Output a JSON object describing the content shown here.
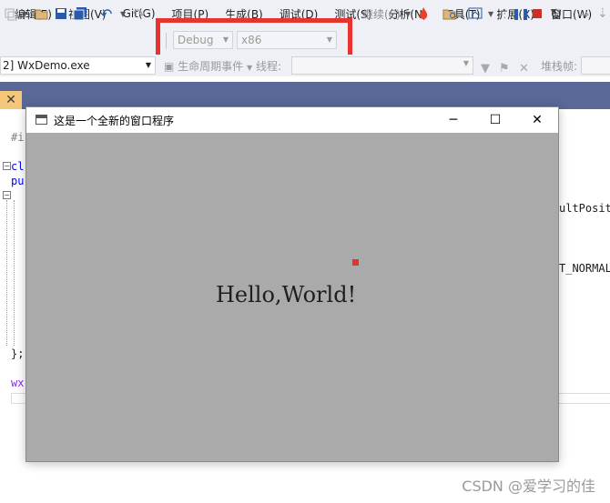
{
  "menu": [
    "编辑(E)",
    "视图(V)",
    "Git(G)",
    "项目(P)",
    "生成(B)",
    "调试(D)",
    "测试(S)",
    "分析(N)",
    "工具(T)",
    "扩展(X)",
    "窗口(W)"
  ],
  "toolbar": {
    "configuration": "Debug",
    "platform": "x86",
    "continue_label": "继续(C)"
  },
  "toolbar2": {
    "process": "2] WxDemo.exe",
    "lifecycle_label": "生命周期事件",
    "thread_label": "线程:",
    "stack_label": "堆栈帧:"
  },
  "editor": {
    "line1": "#i",
    "line2": "cl",
    "line3": "pu",
    "line4": "};",
    "line5": "wx",
    "right1": "ultPosit",
    "right2": "T_NORMAL"
  },
  "app_window": {
    "title": "这是一个全新的窗口程序",
    "text": "Hello,World!",
    "minimize": "─",
    "maximize": "☐",
    "close": "✕",
    "background": "#aaaaaa",
    "dot_color": "#e8302a"
  },
  "tab_close": "✕",
  "watermark": "CSDN @爱学习的佳"
}
